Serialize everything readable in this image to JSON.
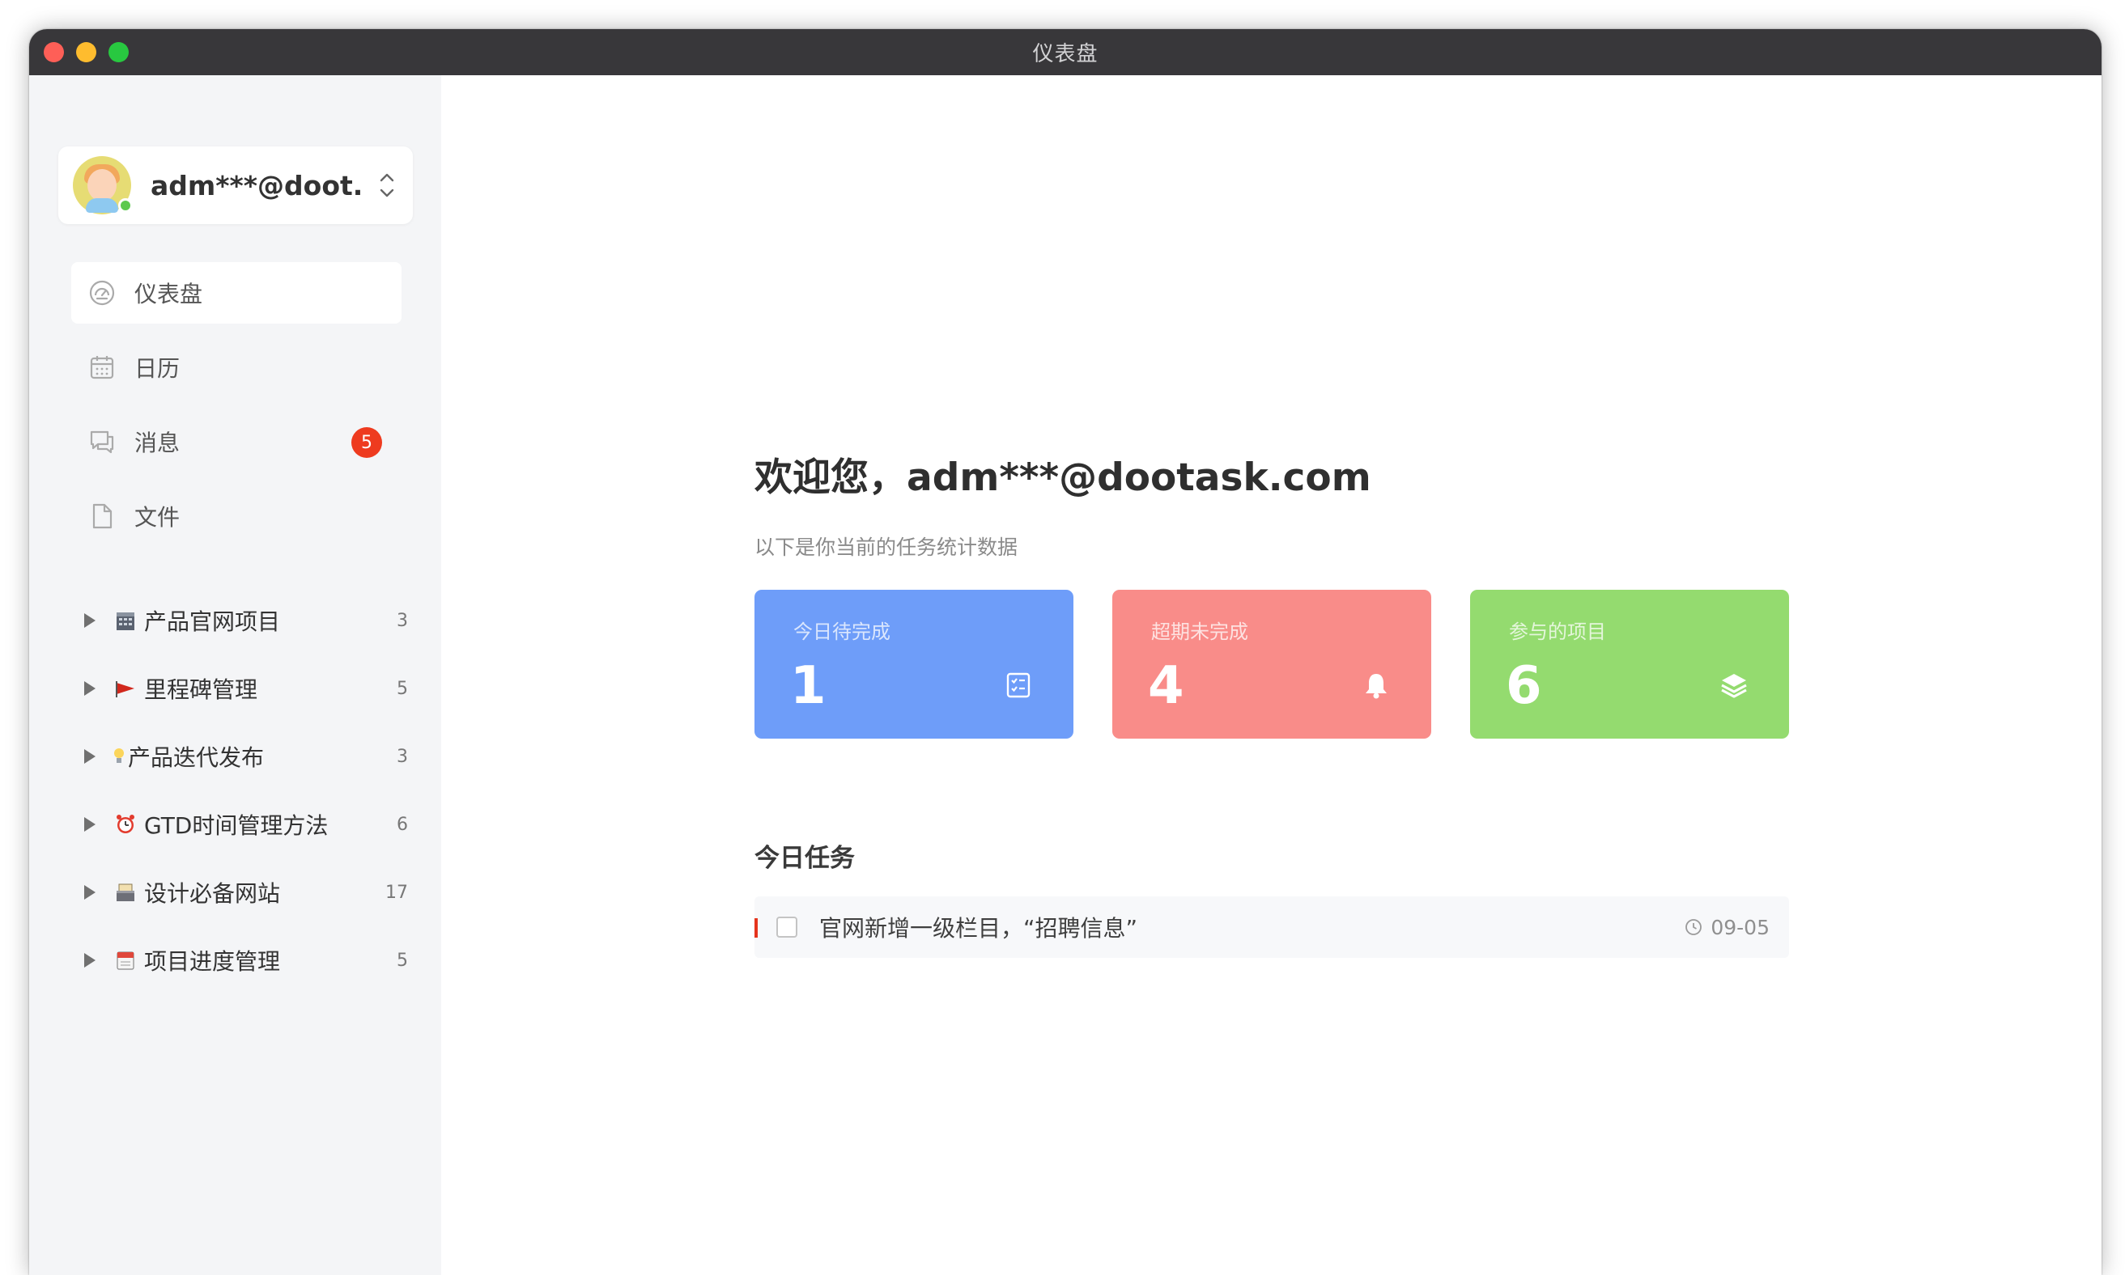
{
  "window": {
    "title": "仪表盘"
  },
  "user": {
    "name": "adm***@doot...",
    "status": "online"
  },
  "nav": [
    {
      "label": "仪表盘",
      "icon": "dashboard-icon",
      "active": true
    },
    {
      "label": "日历",
      "icon": "calendar-icon",
      "active": false
    },
    {
      "label": "消息",
      "icon": "message-icon",
      "active": false,
      "badge": "5"
    },
    {
      "label": "文件",
      "icon": "file-icon",
      "active": false
    }
  ],
  "projects": [
    {
      "icon": "building-icon",
      "name": "产品官网项目",
      "count": "3"
    },
    {
      "icon": "red-flag-icon",
      "name": "里程碑管理",
      "count": "5"
    },
    {
      "icon": "lightbulb-icon",
      "name": "产品迭代发布",
      "count": "3"
    },
    {
      "icon": "alarm-clock-icon",
      "name": "GTD时间管理方法",
      "count": "6"
    },
    {
      "icon": "card-box-icon",
      "name": "设计必备网站",
      "count": "17"
    },
    {
      "icon": "calendar-page-icon",
      "name": "项目进度管理",
      "count": "5"
    }
  ],
  "main": {
    "welcome": "欢迎您，adm***@dootask.com",
    "subtitle": "以下是你当前的任务统计数据",
    "stats": [
      {
        "label": "今日待完成",
        "value": "1",
        "icon": "task-list-icon",
        "color": "#6e9df9"
      },
      {
        "label": "超期未完成",
        "value": "4",
        "icon": "bell-icon",
        "color": "#f98c89"
      },
      {
        "label": "参与的项目",
        "value": "6",
        "icon": "layers-icon",
        "color": "#94db6f"
      }
    ],
    "today_tasks_title": "今日任务",
    "tasks": [
      {
        "title": "官网新增一级栏目，“招聘信息”",
        "date": "09-05",
        "priority_color": "#e5341d",
        "checked": false
      }
    ]
  },
  "colors": {
    "sidebar_bg": "#f4f5f7",
    "badge": "#ee3b1f",
    "bottom_button": "#8ed37a"
  }
}
